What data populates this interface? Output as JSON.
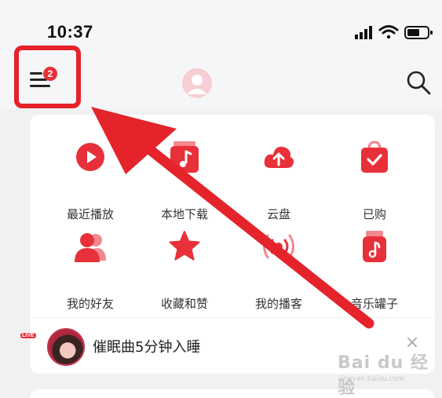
{
  "status_bar": {
    "time": "10:37"
  },
  "header": {
    "menu_badge": "2"
  },
  "quick_grid": [
    {
      "label": "最近播放",
      "icon": "play-icon"
    },
    {
      "label": "本地下载",
      "icon": "local-music-icon"
    },
    {
      "label": "云盘",
      "icon": "cloud-upload-icon"
    },
    {
      "label": "已购",
      "icon": "purchased-bag-icon"
    },
    {
      "label": "我的好友",
      "icon": "friends-icon"
    },
    {
      "label": "收藏和赞",
      "icon": "star-icon"
    },
    {
      "label": "我的播客",
      "icon": "podcast-icon"
    },
    {
      "label": "音乐罐子",
      "icon": "music-jar-icon"
    }
  ],
  "now_playing": {
    "title": "催眠曲5分钟入睡",
    "live_tag": "LIVE",
    "close_label": "×"
  },
  "watermark": {
    "main": "Bai du 经验",
    "sub": "jingyan.baidu.com"
  },
  "colors": {
    "accent": "#e8303a",
    "highlight": "#e5232b"
  }
}
